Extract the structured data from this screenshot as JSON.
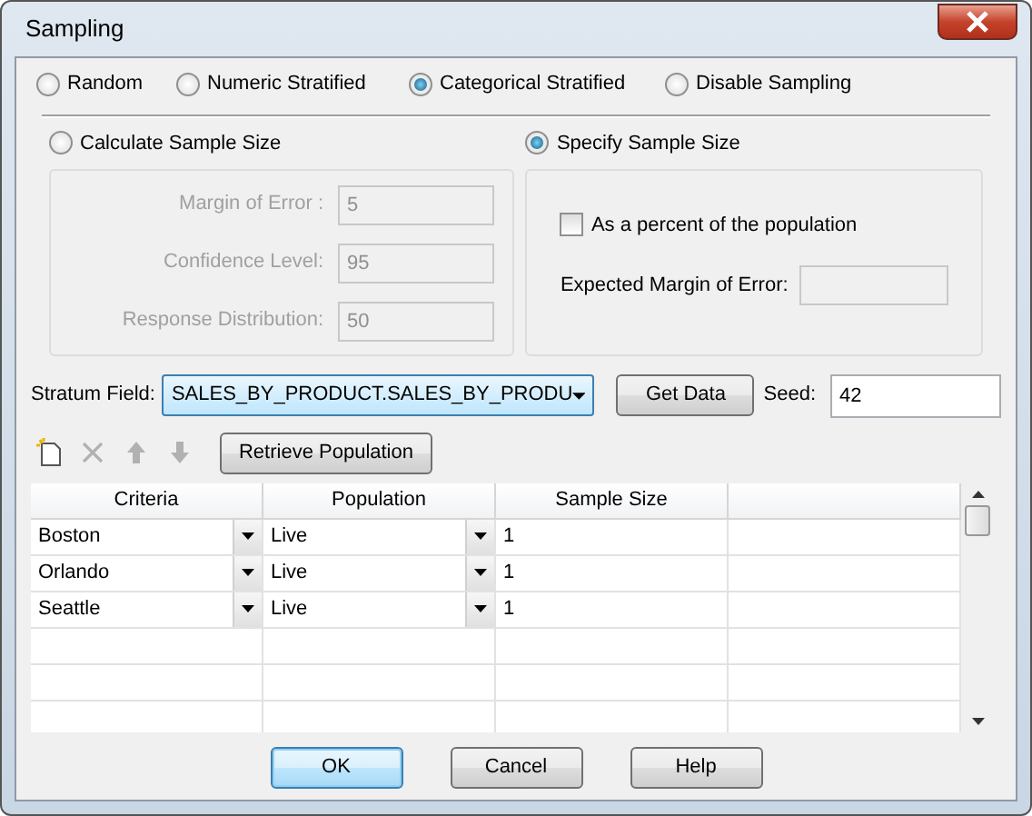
{
  "window": {
    "title": "Sampling"
  },
  "sampling_methods": [
    {
      "label": "Random",
      "selected": false
    },
    {
      "label": "Numeric Stratified",
      "selected": false
    },
    {
      "label": "Categorical Stratified",
      "selected": true
    },
    {
      "label": "Disable Sampling",
      "selected": false
    }
  ],
  "calculate": {
    "label": "Calculate Sample Size",
    "selected": false,
    "disabled": true,
    "fields": [
      {
        "label": "Margin of Error :",
        "value": "5"
      },
      {
        "label": "Confidence Level:",
        "value": "95"
      },
      {
        "label": "Response Distribution:",
        "value": "50"
      }
    ]
  },
  "specify": {
    "label": "Specify Sample Size",
    "selected": true,
    "percent": {
      "label": "As a percent of the population",
      "checked": false
    },
    "expected_margin": {
      "label": "Expected Margin of Error:"
    }
  },
  "stratum": {
    "label": "Stratum Field:",
    "value": "SALES_BY_PRODUCT.SALES_BY_PRODU",
    "get_data": "Get Data",
    "seed_label": "Seed:",
    "seed": "42"
  },
  "toolbar": {
    "tools": [
      {
        "kind": "new",
        "disabled": false
      },
      {
        "kind": "delete",
        "disabled": true
      },
      {
        "kind": "up",
        "disabled": true
      },
      {
        "kind": "down",
        "disabled": true
      }
    ],
    "retrieve": "Retrieve Population"
  },
  "grid": {
    "columns": [
      "Criteria",
      "Population",
      "Sample Size"
    ],
    "rows": [
      {
        "criteria": "Boston",
        "population": "Live",
        "sample_size": "1"
      },
      {
        "criteria": "Orlando",
        "population": "Live",
        "sample_size": "1"
      },
      {
        "criteria": "Seattle",
        "population": "Live",
        "sample_size": "1"
      }
    ]
  },
  "buttons": [
    {
      "label": "OK",
      "default": true
    },
    {
      "label": "Cancel",
      "default": false
    },
    {
      "label": "Help",
      "default": false
    }
  ]
}
